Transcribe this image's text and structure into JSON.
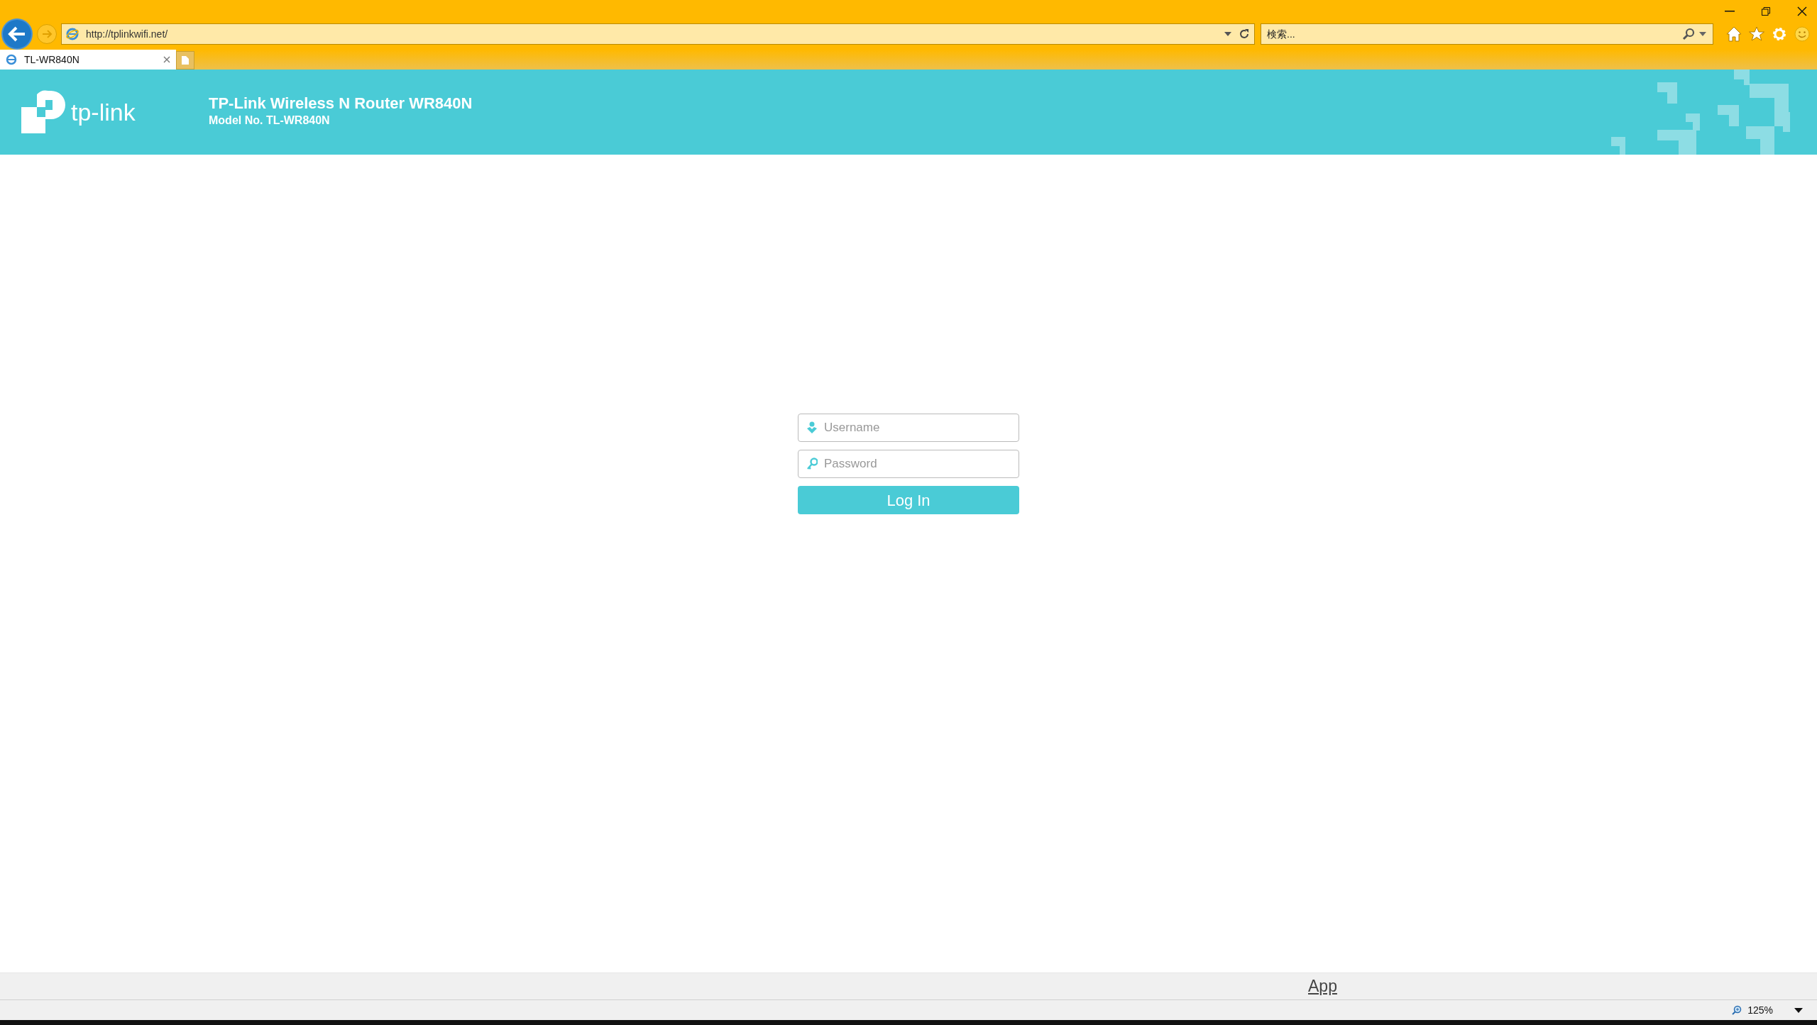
{
  "browser": {
    "address": "http://tplinkwifi.net/",
    "search": {
      "placeholder": "検索..."
    },
    "tabs": [
      {
        "title": "TL-WR840N",
        "selected": true
      }
    ]
  },
  "header": {
    "logo": "tp-link",
    "title": "TP-Link Wireless N Router WR840N",
    "model": "Model No. TL-WR840N"
  },
  "login": {
    "username": {
      "placeholder": "Username"
    },
    "password": {
      "placeholder": "Password"
    },
    "button": "Log In"
  },
  "footer": {
    "link": "App"
  },
  "status_bar": {
    "zoom": "125%"
  }
}
